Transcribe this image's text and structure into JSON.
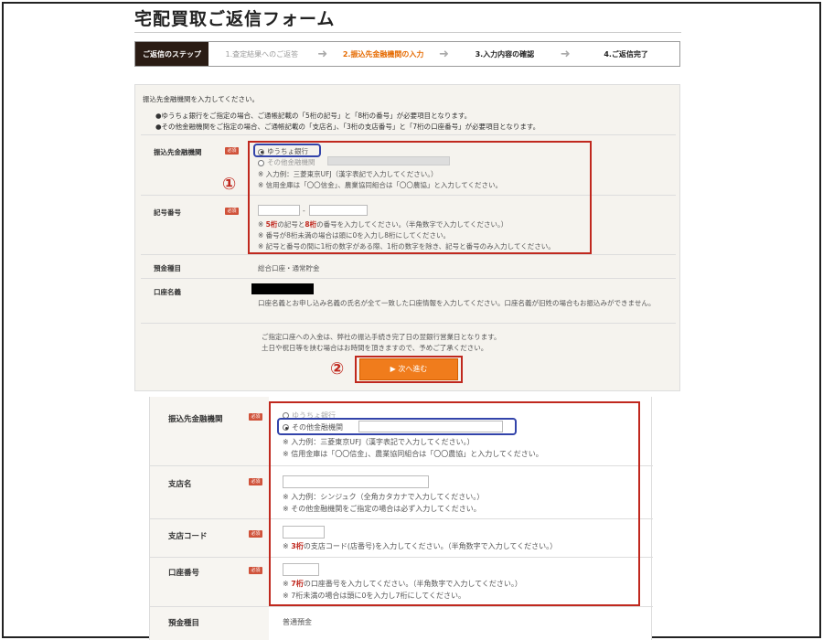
{
  "page": {
    "title": "宅配買取ご返信フォーム"
  },
  "steps": {
    "head": "ご返信のステップ",
    "items": [
      "1.査定結果へのご返答",
      "2.振込先金融機関の入力",
      "3.入力内容の確認",
      "4.ご返信完了"
    ],
    "active_index": 1
  },
  "form1": {
    "lead": "振込先金融機関を入力してください。",
    "note1": "●ゆうちょ銀行をご指定の場合、ご通帳記載の「5桁の記号」と「8桁の番号」が必要項目となります。",
    "note2": "●その他金融機関をご指定の場合、ご通帳記載の「支店名」、「3桁の支店番号」と「7桁の口座番号」が必要項目となります。",
    "required_badge": "必須",
    "bank": {
      "label": "振込先金融機関",
      "option1": "ゆうちょ銀行",
      "option2": "その他金融機関",
      "selected": "ゆうちょ銀行",
      "hint1": "※ 入力例：三菱東京UFJ（漢字表記で入力してください。）",
      "hint2": "※ 信用金庫は「〇〇信金」、農業協同組合は「〇〇農協」と入力してください。"
    },
    "number": {
      "label": "記号番号",
      "separator": "-",
      "hint1_pre": "※ ",
      "hint1_a": "5桁",
      "hint1_mid": "の記号と",
      "hint1_b": "8桁",
      "hint1_post": "の番号を入力してください。（半角数字で入力してください。）",
      "hint2": "※ 番号が8桁未満の場合は頭に0を入力し8桁にしてください。",
      "hint3": "※ 記号と番号の間に1桁の数字がある際、1桁の数字を除き、記号と番号のみ入力してください。"
    },
    "account_type": {
      "label": "預金種目",
      "value": "総合口座・通常貯金"
    },
    "account_name": {
      "label": "口座名義",
      "hint": "口座名義とお申し込み名義の氏名が全て一致した口座情報を入力してください。口座名義が旧姓の場合もお振込みができません。"
    },
    "notice1": "ご指定口座への入金は、弊社の振込手続き完了日の翌銀行営業日となります。",
    "notice2": "土日や祝日等を挟む場合はお時間を頂きますので、予めご了承ください。",
    "next_button": "▶ 次へ進む",
    "marker1": "①",
    "marker2": "②"
  },
  "form2": {
    "required_badge": "必須",
    "bank": {
      "label": "振込先金融機関",
      "option1": "ゆうちょ銀行",
      "option2": "その他金融機関",
      "selected": "その他金融機関",
      "hint1": "※ 入力例：三菱東京UFJ（漢字表記で入力してください。）",
      "hint2": "※ 信用金庫は「〇〇信金」、農業協同組合は「〇〇農協」と入力してください。"
    },
    "branch": {
      "label": "支店名",
      "hint1": "※ 入力例：シンジュク（全角カタカナで入力してください。）",
      "hint2": "※ その他金融機関をご指定の場合は必ず入力してください。"
    },
    "branch_code": {
      "label": "支店コード",
      "hint_pre": "※ ",
      "hint_red": "3桁",
      "hint_post": "の支店コード(店番号)を入力してください。（半角数字で入力してください。）"
    },
    "account_number": {
      "label": "口座番号",
      "hint1_pre": "※ ",
      "hint1_red": "7桁",
      "hint1_post": "の口座番号を入力してください。（半角数字で入力してください。）",
      "hint2": "※ 7桁未満の場合は頭に0を入力し7桁にしてください。"
    },
    "account_type": {
      "label": "預金種目",
      "value": "普通預金"
    }
  }
}
